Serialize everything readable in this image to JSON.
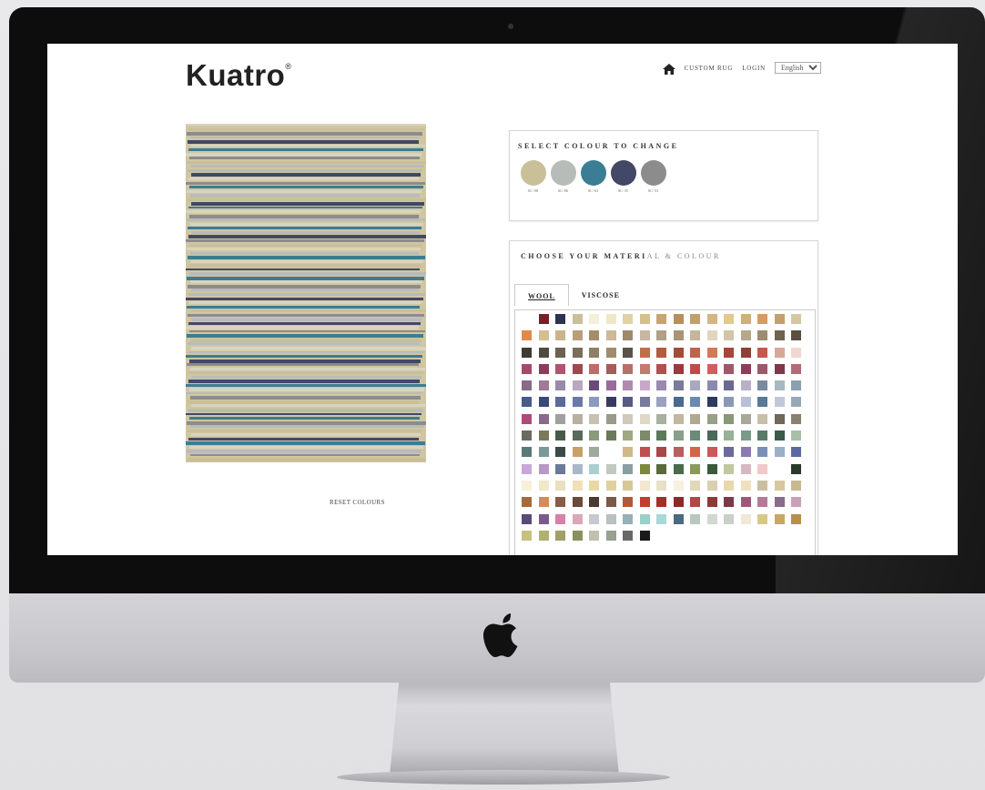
{
  "brand": {
    "name": "Kuatro",
    "reg_mark": "®"
  },
  "nav": {
    "home_icon": "home-icon",
    "custom_rug": "CUSTOM RUG",
    "login": "LOGIN",
    "language": "English",
    "language_options": [
      "English"
    ]
  },
  "rug": {
    "base_color": "#d0c6a2",
    "stripe_colors": {
      "A": "#c9bf98",
      "B": "#b8bcb9",
      "C": "#3b7d94",
      "D": "#424866",
      "E": "#8c8c8c",
      "L": "#d9d4bf"
    },
    "stripes": "LAEBDLCLEABBDLECLBADCLEBLCBDEALBCLADBCLEBBDLCAEBDLECABLBCDELABDCLBEALBDCEBALDCLBEA"
  },
  "reset_label": "RESET COLOURS",
  "select_colour": {
    "title": "SELECT COLOUR TO CHANGE",
    "swatches": [
      {
        "color": "#c9bf98",
        "code": "SC-08"
      },
      {
        "color": "#b8bcb9",
        "code": "SC-86"
      },
      {
        "color": "#3b7d94",
        "code": "SC-63"
      },
      {
        "color": "#424866",
        "code": "SC-35"
      },
      {
        "color": "#8c8c8c",
        "code": "SC-53"
      }
    ]
  },
  "material": {
    "title_main": "CHOOSE YOUR MATERI",
    "title_faded": "AL & COLOUR",
    "tabs": [
      {
        "label": "WOOL",
        "active": true
      },
      {
        "label": "VISCOSE",
        "active": false
      }
    ],
    "palette": [
      "#ffffff",
      "#7a1e2a",
      "#2b3350",
      "#c9bf98",
      "#f3efd9",
      "#efe7c6",
      "#e0d2a5",
      "#d6c08a",
      "#c8a56e",
      "#b88f5a",
      "#c2a06a",
      "#d4b584",
      "#e2c98f",
      "#cfb077",
      "#d99a5e",
      "#c4a06b",
      "#d6c7a0",
      "#e08a4a",
      "#d3bf8f",
      "#c9b48c",
      "#b89f7a",
      "#a48d6a",
      "#cdb996",
      "#9f8a6c",
      "#c6b8a0",
      "#b0a088",
      "#a99478",
      "#c4b69a",
      "#e0d6be",
      "#d1c6a8",
      "#b5a78a",
      "#9c8c70",
      "#6f6450",
      "#5a5040",
      "#3f3a33",
      "#4f4a40",
      "#6b6252",
      "#7a6d5a",
      "#8f7f66",
      "#a08c6d",
      "#5b5249",
      "#c06e4a",
      "#b25c40",
      "#a44a38",
      "#c2624a",
      "#d07a58",
      "#a9453a",
      "#8f3f36",
      "#c25a4e",
      "#d9a79a",
      "#f0d8d0",
      "#a34a6a",
      "#8e3a5a",
      "#b05470",
      "#9b4a50",
      "#c06a6a",
      "#a85a5a",
      "#b8706a",
      "#c57a6e",
      "#b05050",
      "#9a3a40",
      "#c04a4a",
      "#d06060",
      "#a05868",
      "#8a4058",
      "#9a5a6a",
      "#7a3a4a",
      "#b56a7a",
      "#8a6a8a",
      "#a07a98",
      "#9a8aaa",
      "#b8a8c0",
      "#6a4a7a",
      "#9a6a9a",
      "#b08ab0",
      "#c8a8c8",
      "#9a8ab0",
      "#7a7a9a",
      "#aaa8c0",
      "#8a8ab0",
      "#6a6a90",
      "#b8b0c8",
      "#7a8aa0",
      "#a8b8c0",
      "#8aa0b0",
      "#4a5a8a",
      "#3a4a78",
      "#5a6a9a",
      "#6a7aa8",
      "#8a9ac0",
      "#3a3a60",
      "#5a5a80",
      "#7a7aa0",
      "#9aa0c0",
      "#4a6a90",
      "#6a8ab0",
      "#2a3a60",
      "#8a98b8",
      "#b8c0d8",
      "#5a7898",
      "#c0c8d8",
      "#98a8b8",
      "#b04a7a",
      "#8a6a8a",
      "#a0a0a0",
      "#b8b0a0",
      "#c8c0b0",
      "#9a9a8a",
      "#d0c8b8",
      "#e0d8c8",
      "#a8b0a0",
      "#c0b8a0",
      "#b0a890",
      "#98a088",
      "#8a9878",
      "#a8a898",
      "#c8c0a8",
      "#706858",
      "#8a8070",
      "#6a6a60",
      "#7a7a5a",
      "#4a5a4a",
      "#5a6a5a",
      "#8a9a7a",
      "#6a7a5a",
      "#a0a880",
      "#7a8a6a",
      "#5a7a5a",
      "#8aa08a",
      "#6a8a7a",
      "#4a6a5a",
      "#98b098",
      "#7a9a8a",
      "#5a7a6a",
      "#3a5a4a",
      "#a8c0a8",
      "#5a7a78",
      "#7a9a98",
      "#3a4a48",
      "#c8a06a",
      "#a0a8a0",
      "#ffffff",
      "#d0b888",
      "#c05050",
      "#a84848",
      "#b86060",
      "#d06848",
      "#c85a5a",
      "#6a6aa0",
      "#8a7ab0",
      "#7a90b8",
      "#9ab0c8",
      "#5a6aa0",
      "#c8a8d8",
      "#b898c8",
      "#6a7a98",
      "#a8b8c8",
      "#a8d0d0",
      "#c0c8c0",
      "#8aa0a0",
      "#7a8a3a",
      "#5a6a3a",
      "#4a6a4a",
      "#8a9a5a",
      "#3a5a3a",
      "#c0c8a0",
      "#d8b8c0",
      "#f0c8c8",
      "#ffffff",
      "#2a3a2a",
      "#f8f0d8",
      "#f0e8c8",
      "#e8e0c0",
      "#f0e0b8",
      "#e8d8a8",
      "#e0d0a0",
      "#d8c898",
      "#f0e8d0",
      "#e8e0c8",
      "#f8f0e0",
      "#e0d8b8",
      "#d8d0b0",
      "#e8d8b0",
      "#f0e0c0",
      "#c8c0a0",
      "#d8c8a0",
      "#c8b890",
      "#a86a3a",
      "#d88a5a",
      "#8a5a4a",
      "#6a4a3a",
      "#4a3a30",
      "#7a5a4a",
      "#b05a38",
      "#c04030",
      "#a03028",
      "#8a2a28",
      "#b04848",
      "#903838",
      "#7a3a48",
      "#a05878",
      "#b87898",
      "#8a6a8a",
      "#c8a0b8",
      "#5a4a7a",
      "#7a5a8a",
      "#d880a8",
      "#d8a8b8",
      "#c8c8d0",
      "#b8c0c0",
      "#98b0b8",
      "#9ad0c8",
      "#a8d8d8",
      "#4a6a80",
      "#b8c8c0",
      "#d0d8d0",
      "#c8d0c8",
      "#f0e8d8",
      "#d8c888",
      "#c8a860",
      "#b8904a",
      "#c8c080",
      "#b0b070",
      "#a0a068",
      "#8a9060",
      "#c0c0b0",
      "#98a090",
      "#686868",
      "#1a1a1a"
    ]
  }
}
